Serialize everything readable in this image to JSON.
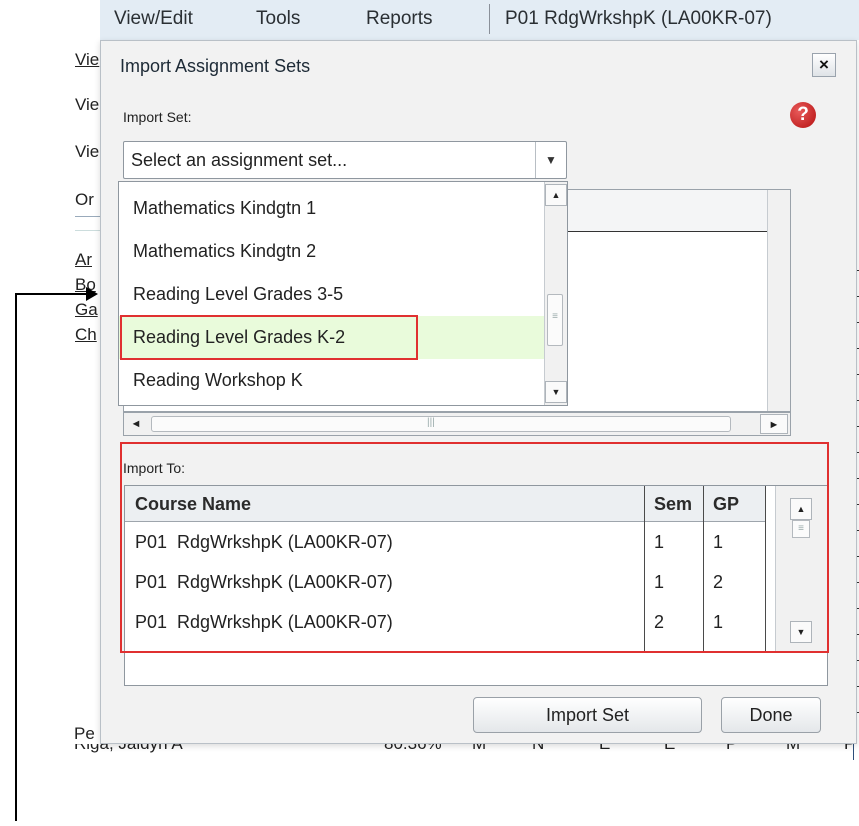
{
  "menubar": {
    "items": [
      "View/Edit",
      "Tools",
      "Reports"
    ],
    "course": "P01  RdgWrkshpK (LA00KR-07)"
  },
  "background": {
    "left_tabs": [
      "Vie",
      "Vie",
      "Vie",
      "Or"
    ],
    "left_links": [
      "Ar",
      "Bo",
      "Ga",
      "Ch"
    ],
    "bottom_left": "Pe",
    "row_name": "Riga, Jaidyn A",
    "row_values": [
      "80.36%",
      "M",
      "N",
      "E",
      "E",
      "P",
      "M",
      "P"
    ]
  },
  "dialog": {
    "title": "Import Assignment Sets",
    "close_label": "×",
    "help_label": "?",
    "import_set_label": "Import Set:",
    "select_placeholder": "Select an assignment set...",
    "options": [
      "Mathematics Kindgtn 1",
      "Mathematics Kindgtn 2",
      "Reading Level Grades 3-5",
      "Reading Level Grades K-2",
      "Reading Workshop K"
    ],
    "selected_option_index": 3,
    "import_to_label": "Import To:",
    "table": {
      "headers": [
        "Course Name",
        "Sem",
        "GP"
      ],
      "rows": [
        [
          "P01  RdgWrkshpK (LA00KR-07)",
          "1",
          "1"
        ],
        [
          "P01  RdgWrkshpK (LA00KR-07)",
          "1",
          "2"
        ],
        [
          "P01  RdgWrkshpK (LA00KR-07)",
          "2",
          "1"
        ]
      ]
    },
    "import_button": "Import Set",
    "done_button": "Done"
  },
  "colors": {
    "highlight_border": "#e03030",
    "selected_row": "#e9fbdb",
    "help_icon": "#c41a1a"
  }
}
